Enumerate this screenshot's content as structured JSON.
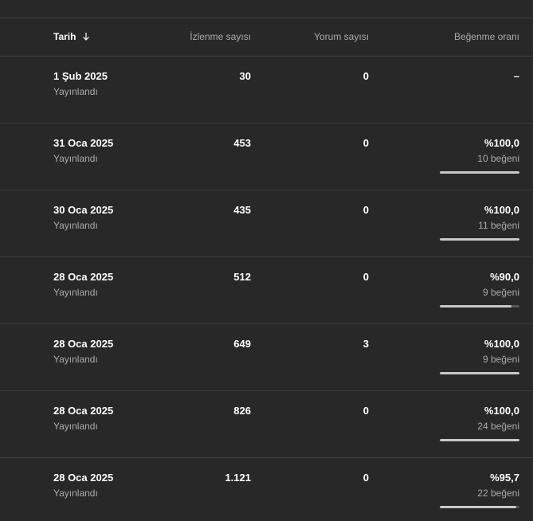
{
  "header": {
    "date_label": "Tarih",
    "views_label": "İzlenme sayısı",
    "comments_label": "Yorum sayısı",
    "likes_label": "Beğenme oranı"
  },
  "rows": [
    {
      "date": "1 Şub 2025",
      "status": "Yayınlandı",
      "views": "30",
      "comments": "0",
      "ratio": "–",
      "like_count": "",
      "ratio_value": null
    },
    {
      "date": "31 Oca 2025",
      "status": "Yayınlandı",
      "views": "453",
      "comments": "0",
      "ratio": "%100,0",
      "like_count": "10 beğeni",
      "ratio_value": 100
    },
    {
      "date": "30 Oca 2025",
      "status": "Yayınlandı",
      "views": "435",
      "comments": "0",
      "ratio": "%100,0",
      "like_count": "11 beğeni",
      "ratio_value": 100
    },
    {
      "date": "28 Oca 2025",
      "status": "Yayınlandı",
      "views": "512",
      "comments": "0",
      "ratio": "%90,0",
      "like_count": "9 beğeni",
      "ratio_value": 90
    },
    {
      "date": "28 Oca 2025",
      "status": "Yayınlandı",
      "views": "649",
      "comments": "3",
      "ratio": "%100,0",
      "like_count": "9 beğeni",
      "ratio_value": 100
    },
    {
      "date": "28 Oca 2025",
      "status": "Yayınlandı",
      "views": "826",
      "comments": "0",
      "ratio": "%100,0",
      "like_count": "24 beğeni",
      "ratio_value": 100
    },
    {
      "date": "28 Oca 2025",
      "status": "Yayınlandı",
      "views": "1.121",
      "comments": "0",
      "ratio": "%95,7",
      "like_count": "22 beğeni",
      "ratio_value": 95.7
    }
  ]
}
